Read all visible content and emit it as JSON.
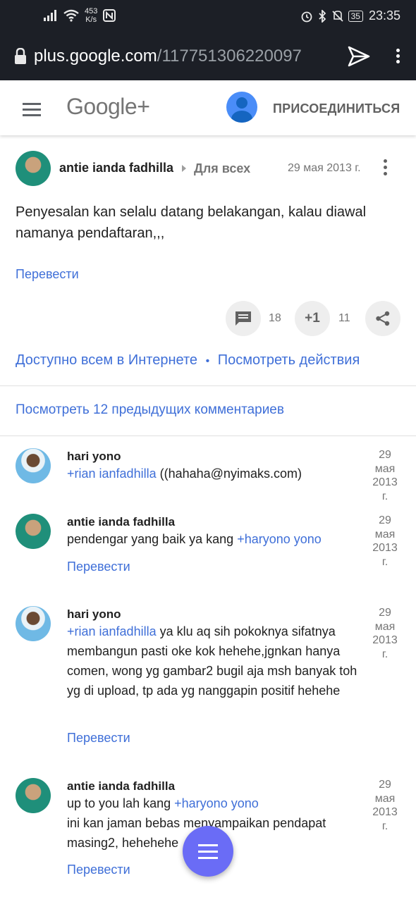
{
  "status_bar": {
    "net_speed_value": "453",
    "net_speed_unit": "K/s",
    "battery": "35",
    "time": "23:35"
  },
  "browser": {
    "url_domain": "plus.google.com",
    "url_path": "/117751306220097"
  },
  "header": {
    "logo": "Google+",
    "join_label": "ПРИСОЕДИНИТЬСЯ"
  },
  "post": {
    "author": "antie ianda fadhilla",
    "audience": "Для всех",
    "date": "29 мая 2013 г.",
    "text": "Penyesalan kan selalu datang belakangan, kalau diawal namanya pendaftaran,,,",
    "translate": "Перевести",
    "comments_count": "18",
    "plusone_label": "+1",
    "plusone_count": "11",
    "visibility": "Доступно всем в Интернете",
    "separator": "•",
    "view_activity": "Посмотреть действия"
  },
  "prev_comments_label": "Посмотреть 12 предыдущих комментариев",
  "comments": [
    {
      "author": "hari yono",
      "mention": "+rian ianfadhilla",
      "text": "((hahaha@nyimaks.com)",
      "date": [
        "29",
        "мая",
        "2013",
        "г."
      ]
    },
    {
      "author": "antie ianda fadhilla",
      "text": "pendengar yang baik ya kang",
      "mention": "+haryono yono",
      "date": [
        "29",
        "мая",
        "2013",
        "г."
      ],
      "translate": "Перевести"
    },
    {
      "author": "hari yono",
      "mention": "+rian ianfadhilla",
      "text": "ya klu aq sih pokoknya sifatnya membangun pasti oke kok hehehe,jgnkan hanya comen, wong yg gambar2 bugil aja msh banyak toh yg di upload, tp ada yg nanggapin positif hehehe",
      "date": [
        "29",
        "мая",
        "2013",
        "г."
      ],
      "translate": "Перевести"
    },
    {
      "author": "antie ianda fadhilla",
      "text": "up to you lah kang",
      "mention": "+haryono yono",
      "text2": "ini kan jaman bebas menyampaikan pendapat masing2, hehehehe",
      "date": [
        "29",
        "мая",
        "2013",
        "г."
      ],
      "translate": "Перевести"
    }
  ]
}
